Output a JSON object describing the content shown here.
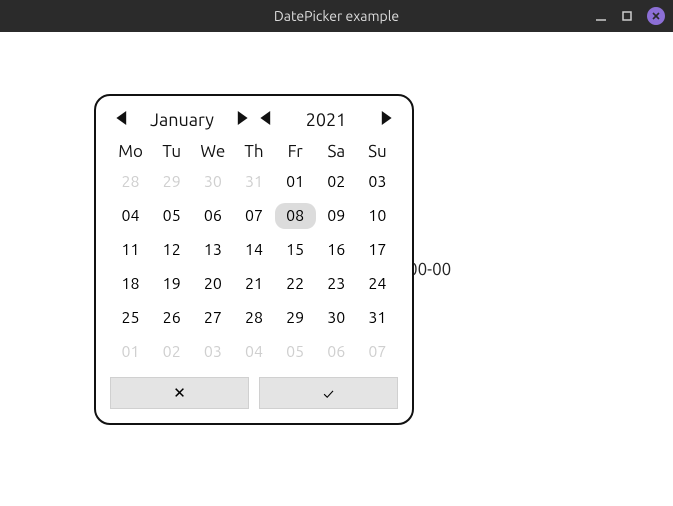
{
  "window": {
    "title": "DatePicker example"
  },
  "background_text": "00-00",
  "picker": {
    "month_label": "January",
    "year_label": "2021",
    "dow": [
      "Mo",
      "Tu",
      "We",
      "Th",
      "Fr",
      "Sa",
      "Su"
    ],
    "selected_day": "08",
    "weeks": [
      [
        {
          "d": "28",
          "out": true
        },
        {
          "d": "29",
          "out": true
        },
        {
          "d": "30",
          "out": true
        },
        {
          "d": "31",
          "out": true
        },
        {
          "d": "01"
        },
        {
          "d": "02"
        },
        {
          "d": "03"
        }
      ],
      [
        {
          "d": "04"
        },
        {
          "d": "05"
        },
        {
          "d": "06"
        },
        {
          "d": "07"
        },
        {
          "d": "08",
          "sel": true
        },
        {
          "d": "09"
        },
        {
          "d": "10"
        }
      ],
      [
        {
          "d": "11"
        },
        {
          "d": "12"
        },
        {
          "d": "13"
        },
        {
          "d": "14"
        },
        {
          "d": "15"
        },
        {
          "d": "16"
        },
        {
          "d": "17"
        }
      ],
      [
        {
          "d": "18"
        },
        {
          "d": "19"
        },
        {
          "d": "20"
        },
        {
          "d": "21"
        },
        {
          "d": "22"
        },
        {
          "d": "23"
        },
        {
          "d": "24"
        }
      ],
      [
        {
          "d": "25"
        },
        {
          "d": "26"
        },
        {
          "d": "27"
        },
        {
          "d": "28"
        },
        {
          "d": "29"
        },
        {
          "d": "30"
        },
        {
          "d": "31"
        }
      ],
      [
        {
          "d": "01",
          "out": true
        },
        {
          "d": "02",
          "out": true
        },
        {
          "d": "03",
          "out": true
        },
        {
          "d": "04",
          "out": true
        },
        {
          "d": "05",
          "out": true
        },
        {
          "d": "06",
          "out": true
        },
        {
          "d": "07",
          "out": true
        }
      ]
    ],
    "cancel_glyph": "✕",
    "confirm_glyph": "✓"
  }
}
